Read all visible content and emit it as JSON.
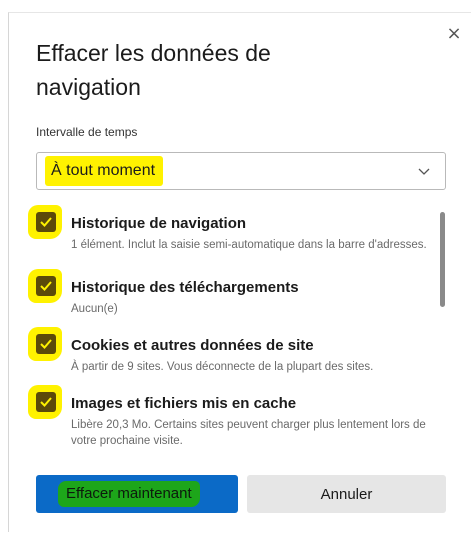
{
  "dialog": {
    "title": "Effacer les données de navigation",
    "close_label": "×"
  },
  "interval": {
    "label": "Intervalle de temps",
    "selected": "À tout moment"
  },
  "items": [
    {
      "title": "Historique de navigation",
      "description": "1 élément. Inclut la saisie semi-automatique dans la barre d'adresses.",
      "checked": true
    },
    {
      "title": "Historique des téléchargements",
      "description": "Aucun(e)",
      "checked": true
    },
    {
      "title": "Cookies et autres données de site",
      "description": "À partir de 9 sites. Vous déconnecte de la plupart des sites.",
      "checked": true
    },
    {
      "title": "Images et fichiers mis en cache",
      "description": "Libère 20,3 Mo. Certains sites peuvent charger plus lentement lors de votre prochaine visite.",
      "checked": true
    }
  ],
  "buttons": {
    "clear_now": "Effacer maintenant",
    "cancel": "Annuler"
  },
  "colors": {
    "primary_button": "#0b6ac7",
    "highlight_yellow": "#fff200",
    "highlight_green": "#1da61a",
    "checkbox_fill": "#5b4a0a"
  }
}
